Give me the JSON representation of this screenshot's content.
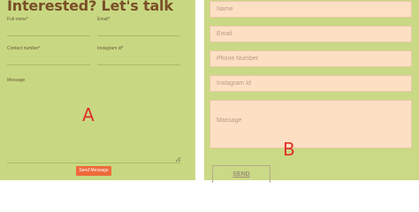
{
  "panel_a": {
    "title": "Interested? Let's talk",
    "labels": {
      "full_name": "Full name*",
      "email": "Email*",
      "contact_number": "Contact number*",
      "instagram_id": "Instagram id*",
      "message": "Message"
    },
    "send_label": "Send Message",
    "marker": "A",
    "colors": {
      "background": "#c8d882",
      "title": "#7a4f27",
      "button": "#ee6a3a",
      "marker": "#e0302a"
    }
  },
  "panel_b": {
    "placeholders": {
      "name": "Name",
      "email": "Email",
      "phone": "Phone Number",
      "instagram": "Instagram Id",
      "message": "Massage"
    },
    "send_label": "SEND",
    "marker": "B",
    "colors": {
      "background": "#cad985",
      "field": "#fde0c4"
    }
  }
}
